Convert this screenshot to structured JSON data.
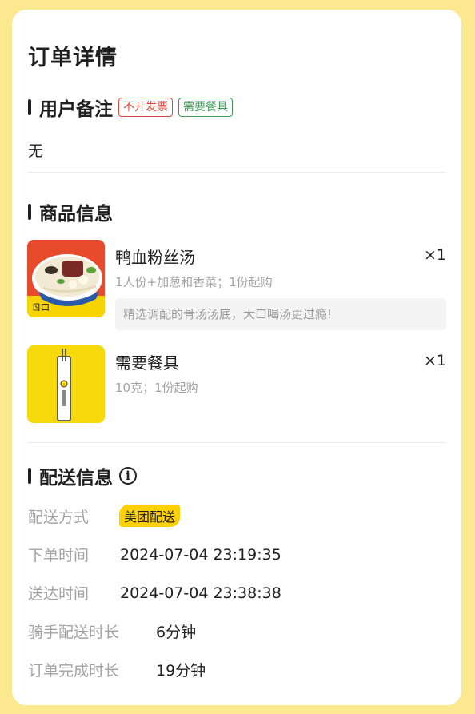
{
  "page": {
    "title": "订单详情"
  },
  "remark_section": {
    "title": "用户备注",
    "tags": [
      {
        "label": "不开发票",
        "color": "#e0473b"
      },
      {
        "label": "需要餐具",
        "color": "#3c9a52"
      }
    ],
    "content": "无"
  },
  "goods_section": {
    "title": "商品信息",
    "items": [
      {
        "name": "鸭血粉丝汤",
        "qty": "×1",
        "spec": "1人份+加葱和香菜；1份起购",
        "desc": "精选调配的骨汤汤底，大口喝汤更过瘾!",
        "image_icon": "soup-bowl-image"
      },
      {
        "name": "需要餐具",
        "qty": "×1",
        "spec": "10克；1份起购",
        "image_icon": "chopsticks-image"
      }
    ]
  },
  "delivery_section": {
    "title": "配送信息",
    "info_icon": "info-icon",
    "rows": [
      {
        "label": "配送方式",
        "value": "美团配送"
      },
      {
        "label": "下单时间",
        "value": "2024-07-04 23:19:35"
      },
      {
        "label": "送达时间",
        "value": "2024-07-04 23:38:38"
      },
      {
        "label": "骑手配送时长",
        "value": "6分钟"
      },
      {
        "label": "订单完成时长",
        "value": "19分钟"
      }
    ]
  },
  "colors": {
    "background": "#fbe88f",
    "brand_yellow": "#ffd000",
    "tag_red": "#e0473b",
    "tag_green": "#3c9a52"
  }
}
